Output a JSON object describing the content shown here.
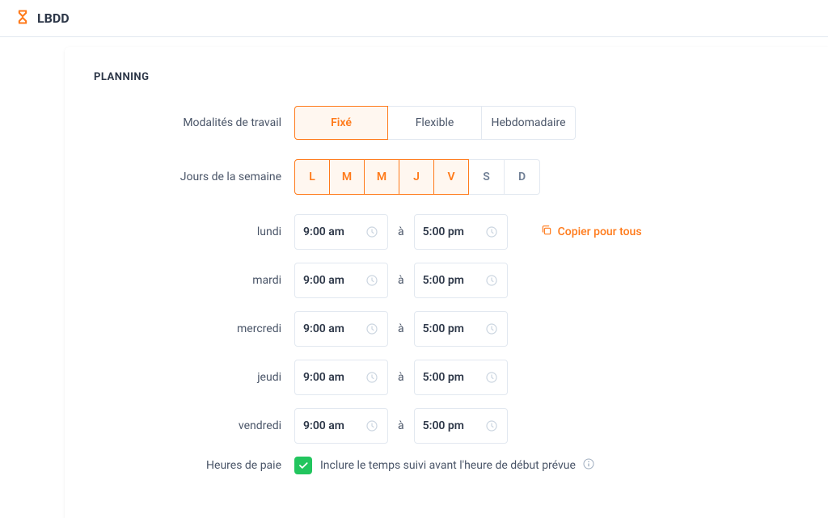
{
  "header": {
    "brand": "LBDD"
  },
  "section_title": "PLANNING",
  "labels": {
    "work_mode": "Modalités de travail",
    "days_of_week": "Jours de la semaine",
    "pay_hours": "Heures de paie",
    "sep": "à"
  },
  "work_modes": [
    {
      "label": "Fixé",
      "active": true
    },
    {
      "label": "Flexible",
      "active": false
    },
    {
      "label": "Hebdomadaire",
      "active": false
    }
  ],
  "days": [
    {
      "letter": "L",
      "active": true
    },
    {
      "letter": "M",
      "active": true
    },
    {
      "letter": "M",
      "active": true
    },
    {
      "letter": "J",
      "active": true
    },
    {
      "letter": "V",
      "active": true
    },
    {
      "letter": "S",
      "active": false
    },
    {
      "letter": "D",
      "active": false
    }
  ],
  "schedule": [
    {
      "name": "lundi",
      "start": "9:00 am",
      "end": "5:00 pm"
    },
    {
      "name": "mardi",
      "start": "9:00 am",
      "end": "5:00 pm"
    },
    {
      "name": "mercredi",
      "start": "9:00 am",
      "end": "5:00 pm"
    },
    {
      "name": "jeudi",
      "start": "9:00 am",
      "end": "5:00 pm"
    },
    {
      "name": "vendredi",
      "start": "9:00 am",
      "end": "5:00 pm"
    }
  ],
  "copy_all": "Copier pour tous",
  "pay_option": {
    "checked": true,
    "label": "Inclure le temps suivi avant l'heure de début prévue"
  },
  "colors": {
    "accent": "#ff7a1a",
    "success": "#22c55e"
  }
}
